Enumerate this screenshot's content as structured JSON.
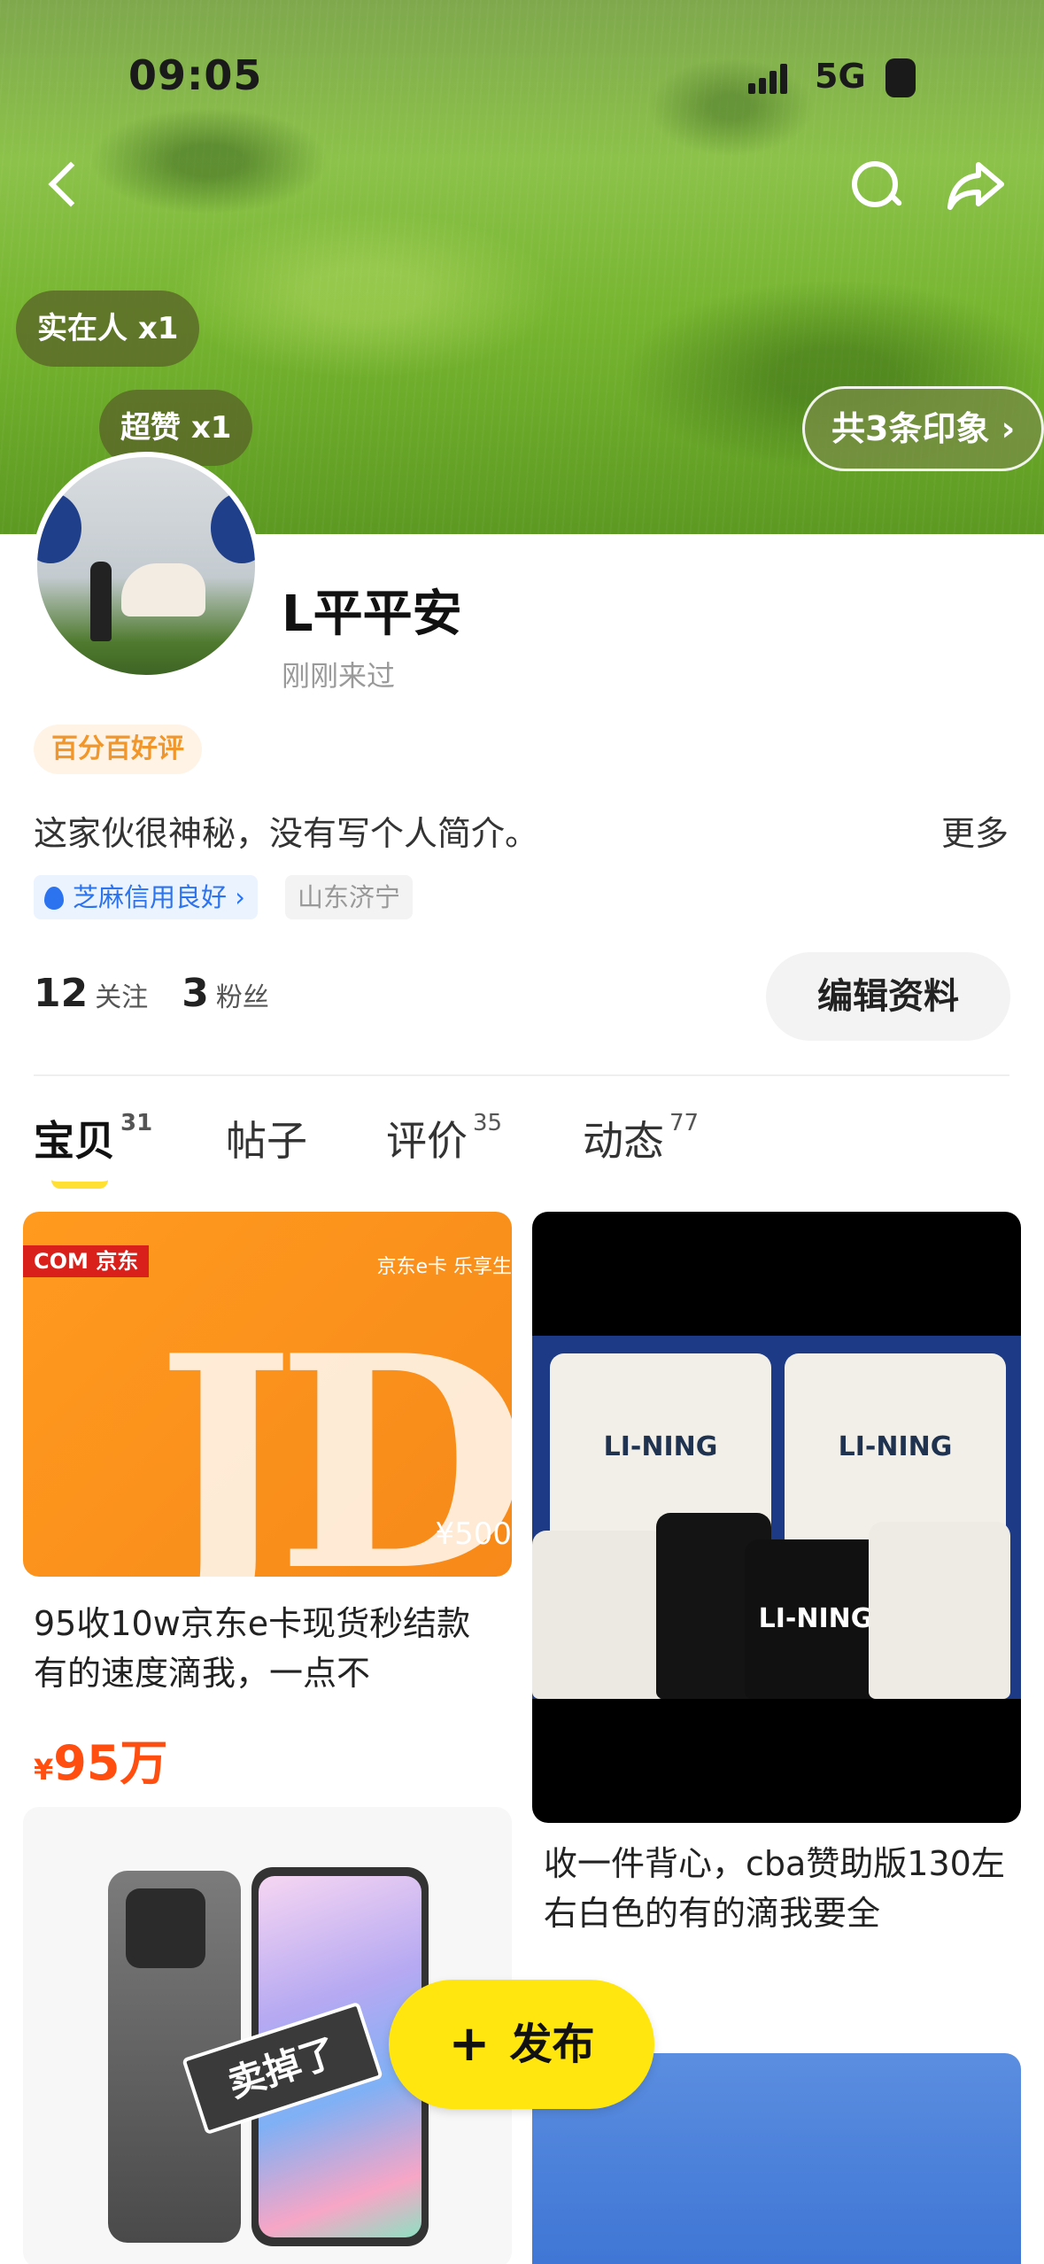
{
  "status_bar": {
    "time": "09:05",
    "network": "5G"
  },
  "header": {
    "tags": [
      {
        "label": "实在人 x1"
      },
      {
        "label": "超赞 x1"
      }
    ],
    "impressions_label": "共3条印象 ›"
  },
  "profile": {
    "name": "L平平安",
    "last_seen": "刚刚来过",
    "rating_badge": "百分百好评",
    "intro": "这家伙很神秘，没有写个人简介。",
    "more_label": "更多",
    "credit_label": "芝麻信用良好 ›",
    "location": "山东济宁",
    "following_count": "12",
    "following_label": "关注",
    "followers_count": "3",
    "followers_label": "粉丝",
    "edit_button": "编辑资料"
  },
  "tabs": [
    {
      "label": "宝贝",
      "count": "31",
      "active": true
    },
    {
      "label": "帖子",
      "count": ""
    },
    {
      "label": "评价",
      "count": "35"
    },
    {
      "label": "动态",
      "count": "77"
    }
  ],
  "items": [
    {
      "image_logo": "COM 京东",
      "image_slogan": "京东e卡 乐享生",
      "image_text": "JD",
      "image_price": "¥500",
      "title": "95收10w京东e卡现货秒结款有的速度滴我，一点不",
      "price_symbol": "¥",
      "price": "95万"
    },
    {
      "image_brand": "LI-NING",
      "title": "收一件背心，cba赞助版130左右白色的有的滴我要全"
    },
    {
      "image_stamp": "卖掉了"
    }
  ],
  "publish_button": "发布",
  "colors": {
    "accent_yellow": "#ffe60f",
    "price_red": "#ff4e0f",
    "credit_blue": "#2c73ef",
    "badge_orange": "#f0962a"
  }
}
